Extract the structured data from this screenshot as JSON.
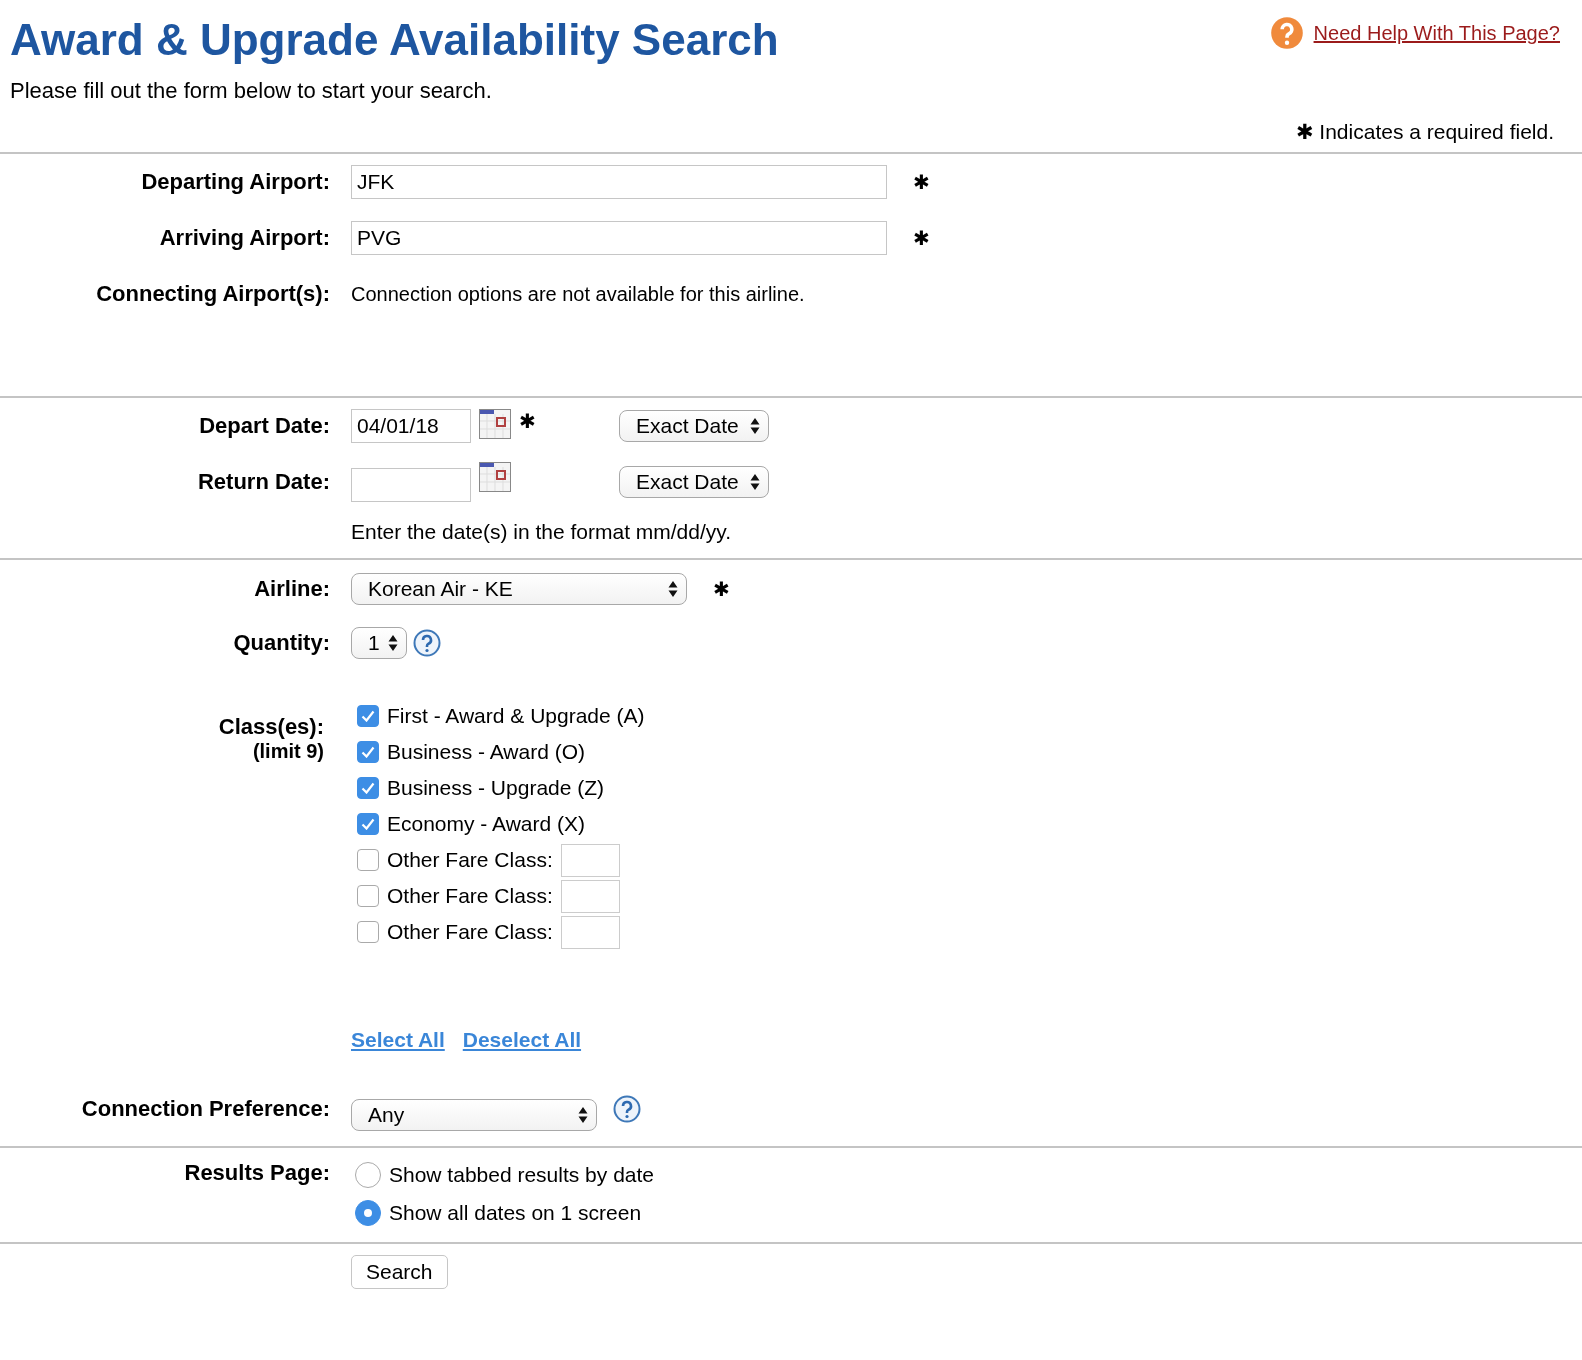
{
  "header": {
    "title": "Award & Upgrade Availability Search",
    "subtitle": "Please fill out the form below to start your search.",
    "help_link": "Need Help With This Page?",
    "required_note": "✱ Indicates a required field."
  },
  "airports": {
    "departing": {
      "label": "Departing Airport:",
      "value": "JFK",
      "required": "✱"
    },
    "arriving": {
      "label": "Arriving Airport:",
      "value": "PVG",
      "required": "✱"
    },
    "connecting": {
      "label": "Connecting Airport(s):",
      "text": "Connection options are not available for this airline."
    }
  },
  "dates": {
    "depart": {
      "label": "Depart Date:",
      "value": "04/01/18",
      "required": "✱",
      "mode": "Exact Date"
    },
    "return": {
      "label": "Return Date:",
      "mode": "Exact Date"
    },
    "hint": "Enter the date(s) in the format mm/dd/yy."
  },
  "airline": {
    "label": "Airline:",
    "value": "Korean Air - KE",
    "required": "✱"
  },
  "quantity": {
    "label": "Quantity:",
    "value": "1"
  },
  "classes": {
    "label": "Class(es):",
    "sublabel": "(limit 9)",
    "items": [
      {
        "kind": "fixed",
        "label": "First - Award & Upgrade (A)",
        "checked": true
      },
      {
        "kind": "fixed",
        "label": "Business - Award (O)",
        "checked": true
      },
      {
        "kind": "fixed",
        "label": "Business - Upgrade (Z)",
        "checked": true
      },
      {
        "kind": "fixed",
        "label": "Economy - Award (X)",
        "checked": true
      },
      {
        "kind": "other",
        "label": "Other Fare Class:",
        "checked": false
      },
      {
        "kind": "other",
        "label": "Other Fare Class:",
        "checked": false
      },
      {
        "kind": "other",
        "label": "Other Fare Class:",
        "checked": false
      }
    ],
    "select_all": "Select All",
    "deselect_all": "Deselect All"
  },
  "connection_preference": {
    "label": "Connection Preference:",
    "value": "Any"
  },
  "results_page": {
    "label": "Results Page:",
    "options": [
      {
        "label": "Show tabbed results by date",
        "selected": false
      },
      {
        "label": "Show all dates on 1 screen",
        "selected": true
      }
    ]
  },
  "search_button": "Search"
}
